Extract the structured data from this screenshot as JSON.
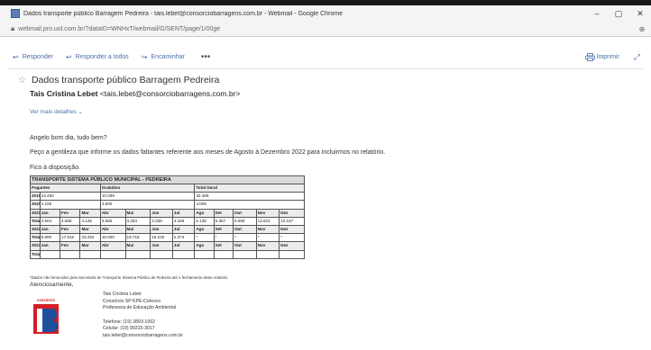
{
  "window": {
    "title": "Dados transporte público Barragem Pedreira - tais.lebet@consorciobarragens.com.br - Webmail - Google Chrome",
    "min": "–",
    "max": "▢",
    "close": "✕"
  },
  "address": {
    "url": "webmail.pro.uol.com.br/?dataID=WNHxT/webmail/G/SENT/page/1/00ge",
    "zoom": "⊕"
  },
  "toolbar": {
    "reply": "Responder",
    "reply_all": "Responder a todos",
    "forward": "Encaminhar",
    "more": "•••",
    "print": "Imprimir"
  },
  "message": {
    "subject": "Dados transporte público Barragem Pedreira",
    "sender_name": "Tais Cristina Lebet",
    "sender_email": "<tais.lebet@consorciobarragens.com.br>",
    "details_link": "Ver mais detalhes",
    "greeting": "Angelo bom dia, tudo bem?",
    "request": "Peço a gentileza que informe os dados faltantes referente aos meses de Agosto à Dezembro 2022 para incluirmos no relatório.",
    "available": "Fico à disposição."
  },
  "table": {
    "title": "TRANSPORTE SISTEMA PÚBLICO MUNICIPAL - PEDREIRA",
    "header": [
      "Pagantes",
      "Gratuitos",
      "Total Geral"
    ],
    "summary": [
      [
        "2019",
        "23.450",
        "10.039",
        "33.489"
      ],
      [
        "2020",
        "4.226",
        "3.800",
        "4.009"
      ]
    ],
    "months": [
      "Jan",
      "Fev",
      "Mar",
      "Abr",
      "Mai",
      "Jun",
      "Jul",
      "Ago",
      "Set",
      "Out",
      "Nov",
      "Dez"
    ],
    "blocks": [
      {
        "year": "2021",
        "total": [
          "4.504",
          "4.585",
          "4.125",
          "3.655",
          "4.283",
          "4.339",
          "4.158",
          "5.138",
          "5.367",
          "8.506",
          "13.622",
          "10.167"
        ]
      },
      {
        "year": "2022",
        "total": [
          "8.690",
          "17.816",
          "23.252",
          "18.000",
          "19.718",
          "18.220",
          "2.374",
          "*",
          "*",
          "*",
          "*",
          "*"
        ]
      },
      {
        "year": "2023",
        "total": [
          "",
          "",
          "",
          "",
          "",
          "",
          "",
          "",
          "",
          "",
          "",
          ""
        ]
      }
    ],
    "total_label": "Total"
  },
  "footnote": "*Dados não fornecidos pela Secretaria de Transporte Sistema Público de Pedreira até o fechamento deste relatório",
  "closing": "Atenciosamente,",
  "signature": {
    "name": "Tais Cristina Lebet",
    "org": "Consórcio SP KPE-Cetesco",
    "role": "Professora de Educação Ambiental",
    "phone": "Telefone: (19) 3893-1062",
    "mobile": "Celular: (19) 99315-3017",
    "email": "tais.lebet@consorciobarragens.com.br"
  },
  "logo": {
    "caption": "consórcio",
    "letter": "P"
  },
  "colors": {
    "link": "#4a6ea9",
    "logo_red": "#d21f26",
    "logo_blue": "#1d4f9c"
  }
}
